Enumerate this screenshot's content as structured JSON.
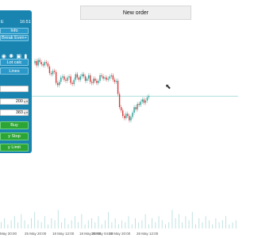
{
  "toolbar": {
    "new_order_label": "New order"
  },
  "panel": {
    "top_left": "E",
    "time": "16:51",
    "info_label": "Info",
    "break_even_label": "Break Even+",
    "lot_calc_label": "Lot calc",
    "lines_label": "Lines",
    "input1_value": "200",
    "input2_value": "383",
    "buy_label": "Buy",
    "buy_stop_label": "y Stop",
    "buy_limit_label": "y Limit",
    "icons": [
      "eye-icon",
      "gear-icon",
      "lock-icon",
      "bar-icon"
    ]
  },
  "x_axis_labels": [
    "May 20:00",
    "25 May 20:00",
    "18 May 12:00",
    "18 May 20:00",
    "25 May 04:00",
    "23 May 20:00",
    "26 May 12:00"
  ],
  "chart_data": {
    "type": "candlestick",
    "price_line_color": "#7dc9c9",
    "candles": [
      {
        "o": 98,
        "c": 100
      },
      {
        "o": 100,
        "c": 96
      },
      {
        "o": 96,
        "c": 101
      },
      {
        "o": 101,
        "c": 99
      },
      {
        "o": 99,
        "c": 97
      },
      {
        "o": 97,
        "c": 96
      },
      {
        "o": 96,
        "c": 99
      },
      {
        "o": 99,
        "c": 98
      },
      {
        "o": 98,
        "c": 95
      },
      {
        "o": 95,
        "c": 89
      },
      {
        "o": 89,
        "c": 88
      },
      {
        "o": 88,
        "c": 91
      },
      {
        "o": 91,
        "c": 90
      },
      {
        "o": 90,
        "c": 80
      },
      {
        "o": 80,
        "c": 78
      },
      {
        "o": 78,
        "c": 81
      },
      {
        "o": 81,
        "c": 85
      },
      {
        "o": 85,
        "c": 86
      },
      {
        "o": 86,
        "c": 83
      },
      {
        "o": 83,
        "c": 82
      },
      {
        "o": 82,
        "c": 85
      },
      {
        "o": 85,
        "c": 86
      },
      {
        "o": 86,
        "c": 80
      },
      {
        "o": 80,
        "c": 79
      },
      {
        "o": 79,
        "c": 83
      },
      {
        "o": 83,
        "c": 88
      },
      {
        "o": 88,
        "c": 85
      },
      {
        "o": 85,
        "c": 83
      },
      {
        "o": 83,
        "c": 86
      },
      {
        "o": 86,
        "c": 88
      },
      {
        "o": 88,
        "c": 86
      },
      {
        "o": 86,
        "c": 82
      },
      {
        "o": 82,
        "c": 84
      },
      {
        "o": 84,
        "c": 87
      },
      {
        "o": 87,
        "c": 81
      },
      {
        "o": 81,
        "c": 80
      },
      {
        "o": 80,
        "c": 84
      },
      {
        "o": 84,
        "c": 82
      },
      {
        "o": 82,
        "c": 80
      },
      {
        "o": 80,
        "c": 82
      },
      {
        "o": 82,
        "c": 87
      },
      {
        "o": 87,
        "c": 86
      },
      {
        "o": 86,
        "c": 84
      },
      {
        "o": 84,
        "c": 85
      },
      {
        "o": 85,
        "c": 83
      },
      {
        "o": 83,
        "c": 84
      },
      {
        "o": 84,
        "c": 86
      },
      {
        "o": 86,
        "c": 87
      },
      {
        "o": 87,
        "c": 83
      },
      {
        "o": 83,
        "c": 81
      },
      {
        "o": 81,
        "c": 82
      },
      {
        "o": 82,
        "c": 70
      },
      {
        "o": 70,
        "c": 58
      },
      {
        "o": 58,
        "c": 55
      },
      {
        "o": 55,
        "c": 50
      },
      {
        "o": 50,
        "c": 48
      },
      {
        "o": 48,
        "c": 52
      },
      {
        "o": 52,
        "c": 50
      },
      {
        "o": 50,
        "c": 46
      },
      {
        "o": 46,
        "c": 49
      },
      {
        "o": 49,
        "c": 53
      },
      {
        "o": 53,
        "c": 58
      },
      {
        "o": 58,
        "c": 56
      },
      {
        "o": 56,
        "c": 61
      },
      {
        "o": 61,
        "c": 60
      },
      {
        "o": 60,
        "c": 63
      },
      {
        "o": 63,
        "c": 65
      },
      {
        "o": 65,
        "c": 62
      },
      {
        "o": 62,
        "c": 64
      },
      {
        "o": 64,
        "c": 67
      },
      {
        "o": 67,
        "c": 68
      }
    ],
    "price_line_value": 68,
    "volumes": [
      3,
      5,
      2,
      4,
      6,
      3,
      7,
      4,
      2,
      5,
      8,
      4,
      3,
      6,
      2,
      5,
      4,
      9,
      3,
      5,
      2,
      4,
      6,
      3,
      7,
      2,
      4,
      5,
      3,
      6,
      2,
      4,
      8,
      3,
      5,
      2,
      4,
      3,
      6,
      2,
      5,
      3,
      4,
      7,
      2,
      5,
      3,
      6,
      4,
      2,
      3,
      9,
      5,
      7,
      3,
      6,
      4,
      8,
      2,
      5,
      3,
      6,
      4,
      2,
      5,
      3,
      4,
      6,
      2,
      3,
      4
    ]
  }
}
